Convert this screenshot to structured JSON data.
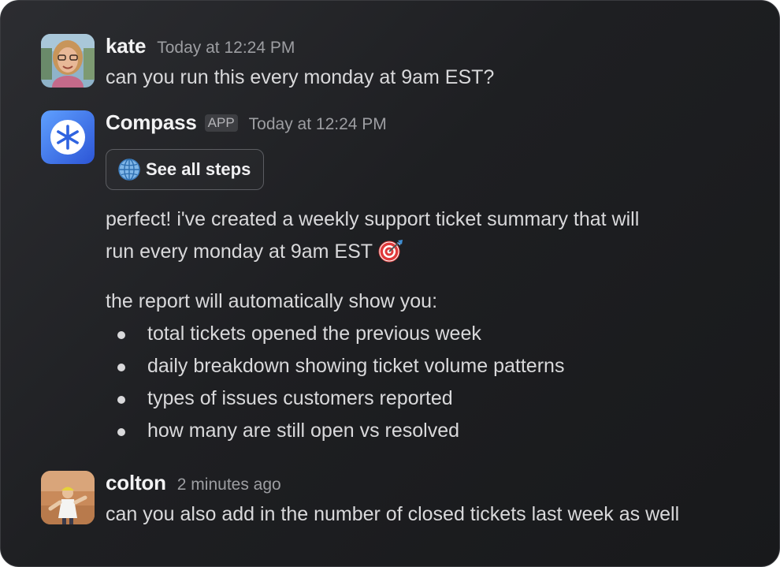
{
  "messages": {
    "kate": {
      "name": "kate",
      "time": "Today at 12:24 PM",
      "text": "can you run this every monday at 9am EST?",
      "avatar_icon": "kate-avatar-photo"
    },
    "compass": {
      "name": "Compass",
      "badge": "APP",
      "time": "Today at 12:24 PM",
      "steps_button_label": "See all steps",
      "steps_button_icon": "globe-icon",
      "line1": "perfect! i've created a weekly support ticket summary that will",
      "line2": "run every monday at 9am EST",
      "line2_emoji": "direct-hit-target-icon",
      "intro": "the report will automatically show you:",
      "bullets": [
        "total tickets opened the previous week",
        "daily breakdown showing ticket volume patterns",
        "types of issues customers reported",
        "how many are still open vs resolved"
      ],
      "avatar_icon": "compass-asterisk-logo",
      "accent_color": "#3b6fe6"
    },
    "colton": {
      "name": "colton",
      "time": "2 minutes ago",
      "text": "can you also add in the number of closed tickets last week as well",
      "avatar_icon": "colton-avatar-photo"
    }
  }
}
